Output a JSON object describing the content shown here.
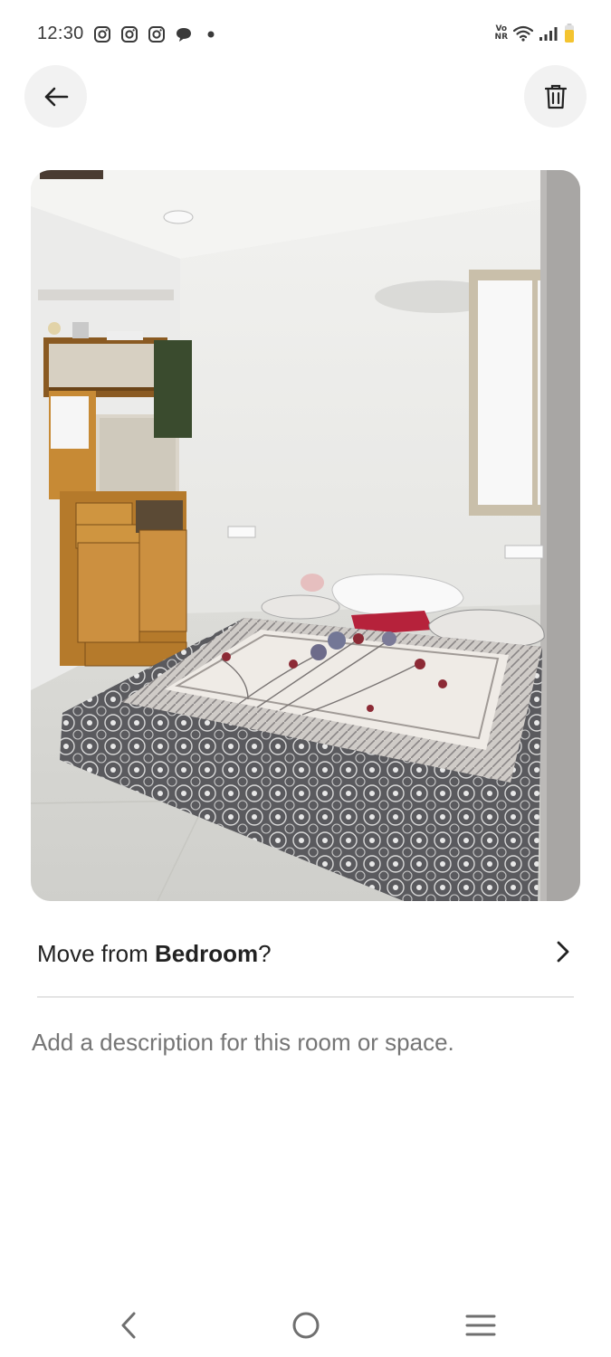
{
  "status_bar": {
    "time": "12:30",
    "notification_icons": [
      "instagram-icon",
      "instagram-icon",
      "instagram-icon",
      "chat-bubble-icon",
      "dot-icon"
    ],
    "network_label_top": "Vo",
    "network_label_bottom": "NR",
    "system_icons": [
      "volte-icon",
      "wifi-icon",
      "signal-icon",
      "battery-icon"
    ],
    "battery_color": "#f4c430"
  },
  "header": {
    "back_icon": "arrow-left-icon",
    "delete_icon": "trash-icon"
  },
  "photo": {
    "subject": "bedroom-photo"
  },
  "move_row": {
    "prefix": "Move from ",
    "room": "Bedroom",
    "suffix": "?",
    "icon": "chevron-right-icon"
  },
  "description": {
    "placeholder": "Add a description for this room or space."
  },
  "nav_bar": {
    "icons": [
      "nav-back-icon",
      "nav-home-icon",
      "nav-menu-icon"
    ]
  },
  "colors": {
    "text_primary": "#222222",
    "text_secondary": "#717171",
    "button_bg": "#f2f2f2",
    "divider": "#e4e4e4"
  }
}
